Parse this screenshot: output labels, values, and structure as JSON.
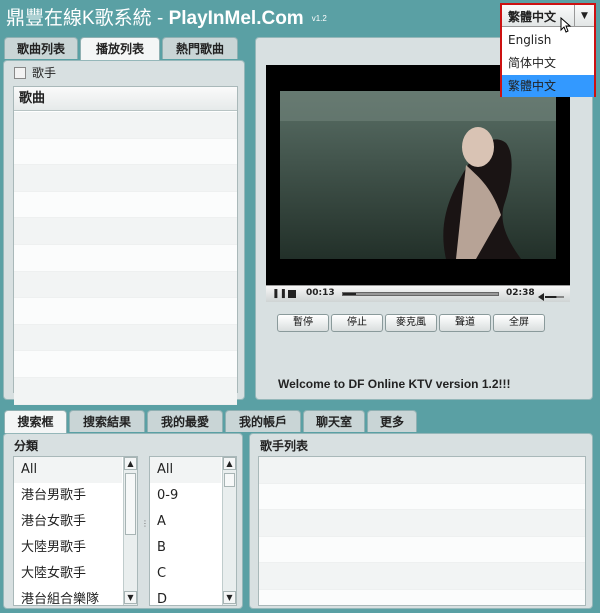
{
  "app": {
    "title_main": "鼎豐在線K歌系統 - ",
    "title_brand": "PlayInMel.Com",
    "version": "v1.2"
  },
  "language": {
    "selected": "繁體中文",
    "options": [
      "English",
      "简体中文",
      "繁體中文"
    ],
    "highlight_color": "#3399ff"
  },
  "playlist_panel": {
    "tabs": [
      "歌曲列表",
      "播放列表",
      "熱門歌曲"
    ],
    "active_tab": "播放列表",
    "checkbox_label": "歌手",
    "column_header": "歌曲"
  },
  "player": {
    "time_current": "00:13",
    "time_total": "02:38",
    "progress": 0.08,
    "volume": 0.6,
    "buttons": [
      "暫停",
      "停止",
      "麥克風",
      "聲道",
      "全屏"
    ],
    "welcome": "Welcome to DF Online KTV version 1.2!!!"
  },
  "search_panel": {
    "tabs": [
      "搜索框",
      "搜索結果",
      "我的最愛",
      "我的帳戶",
      "聊天室",
      "更多"
    ],
    "active_tab": "搜索框",
    "category_label": "分類",
    "categories": [
      "All",
      "港台男歌手",
      "港台女歌手",
      "大陸男歌手",
      "大陸女歌手",
      "港台組合樂隊"
    ],
    "letters": [
      "All",
      "0-9",
      "A",
      "B",
      "C",
      "D"
    ],
    "singer_list_label": "歌手列表"
  },
  "colors": {
    "background": "#5aa0a4",
    "panel": "#d8e0e1",
    "dropdown_border": "#cc1111"
  }
}
